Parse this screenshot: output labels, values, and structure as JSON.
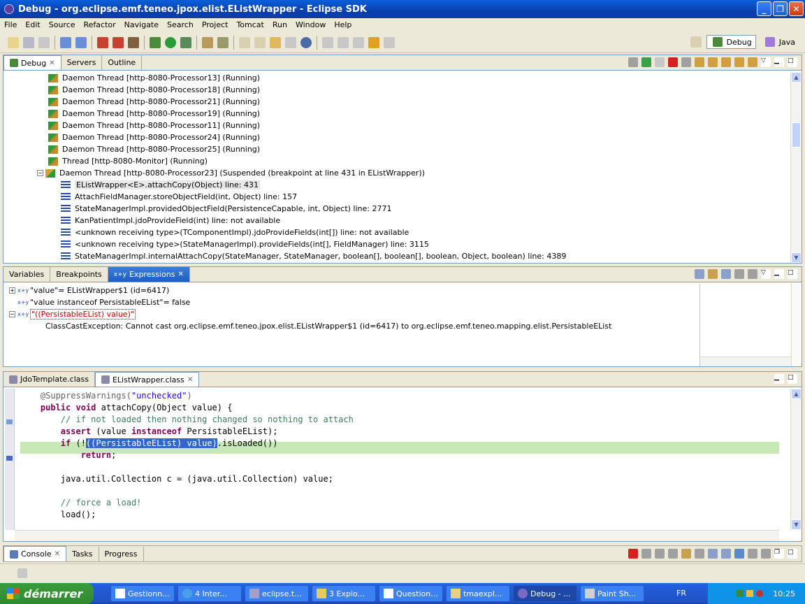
{
  "window": {
    "title": "Debug - org.eclipse.emf.teneo.jpox.elist.EListWrapper - Eclipse SDK"
  },
  "menu": [
    "File",
    "Edit",
    "Source",
    "Refactor",
    "Navigate",
    "Search",
    "Project",
    "Tomcat",
    "Run",
    "Window",
    "Help"
  ],
  "perspectives": {
    "debug": "Debug",
    "java": "Java"
  },
  "debug_view": {
    "tabs": [
      "Debug",
      "Servers",
      "Outline"
    ],
    "threads": [
      "Daemon Thread [http-8080-Processor13] (Running)",
      "Daemon Thread [http-8080-Processor18] (Running)",
      "Daemon Thread [http-8080-Processor21] (Running)",
      "Daemon Thread [http-8080-Processor19] (Running)",
      "Daemon Thread [http-8080-Processor11] (Running)",
      "Daemon Thread [http-8080-Processor24] (Running)",
      "Daemon Thread [http-8080-Processor25] (Running)",
      "Thread [http-8080-Monitor] (Running)",
      "Daemon Thread [http-8080-Processor23] (Suspended (breakpoint at line 431 in EListWrapper))"
    ],
    "frames": [
      "EListWrapper<E>.attachCopy(Object) line: 431",
      "AttachFieldManager.storeObjectField(int, Object) line: 157",
      "StateManagerImpl.providedObjectField(PersistenceCapable, int, Object) line: 2771",
      "KanPatientImpl.jdoProvideField(int) line: not available",
      "<unknown receiving type>(TComponentImpl).jdoProvideFields(int[]) line: not available",
      "<unknown receiving type>(StateManagerImpl).provideFields(int[], FieldManager) line: 3115",
      "StateManagerImpl.internalAttachCopy(StateManager, StateManager, boolean[], boolean[], boolean, Object, boolean) line: 4389"
    ]
  },
  "expr_view": {
    "tabs": [
      "Variables",
      "Breakpoints",
      "Expressions"
    ],
    "items": [
      "\"value\"= EListWrapper$1  (id=6417)",
      "\"value instanceof PersistableEList\"= false",
      "\"((PersistableEList) value)\""
    ],
    "error": "ClassCastException: Cannot cast org.eclipse.emf.teneo.jpox.elist.EListWrapper$1 (id=6417) to org.eclipse.emf.teneo.mapping.elist.PersistableEList"
  },
  "editor": {
    "tabs": [
      "JdoTemplate.class",
      "EListWrapper.class"
    ]
  },
  "console": {
    "tabs": [
      "Console",
      "Tasks",
      "Progress"
    ]
  },
  "taskbar": {
    "start": "démarrer",
    "tasks": [
      "Gestionn...",
      "4 Inter...",
      "eclipse.t...",
      "3 Explo...",
      "Question...",
      "tmaexpl...",
      "Debug - ...",
      "Paint Sh..."
    ],
    "lang": "FR",
    "clock": "10:25"
  }
}
